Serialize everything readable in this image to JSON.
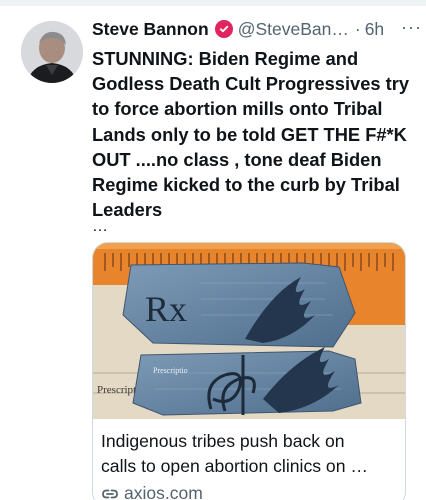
{
  "tweet": {
    "author_name": "Steve Bannon",
    "handle": "@SteveBan…",
    "separator": "·",
    "time": "6h",
    "more": "···",
    "text_lines": [
      "STUNNING: Biden Regime and",
      "Godless Death Cult Progressives try",
      "to force abortion mills onto Tribal",
      "Lands only to be told GET THE F#*K",
      "OUT ....no class , tone deaf Biden",
      "Regime kicked to the curb by Tribal",
      "Leaders"
    ],
    "truncation": "…"
  },
  "card": {
    "title_lines": [
      "Indigenous tribes push back on",
      "calls to open abortion clinics on …"
    ],
    "domain": "axios.com",
    "image_text": {
      "rx": "Rx",
      "prescription_bottom": "Prescriptic",
      "prescription_center": "Prescriptio"
    }
  },
  "colors": {
    "badge": "#e0245e",
    "secondary_text": "#536471",
    "card_border": "#cfd9de",
    "paper_blue": "#5f7f9e",
    "background_orange": "#e8842c"
  },
  "icons": {
    "badge": "verified-badge-icon",
    "more": "more-icon",
    "link": "link-icon"
  }
}
